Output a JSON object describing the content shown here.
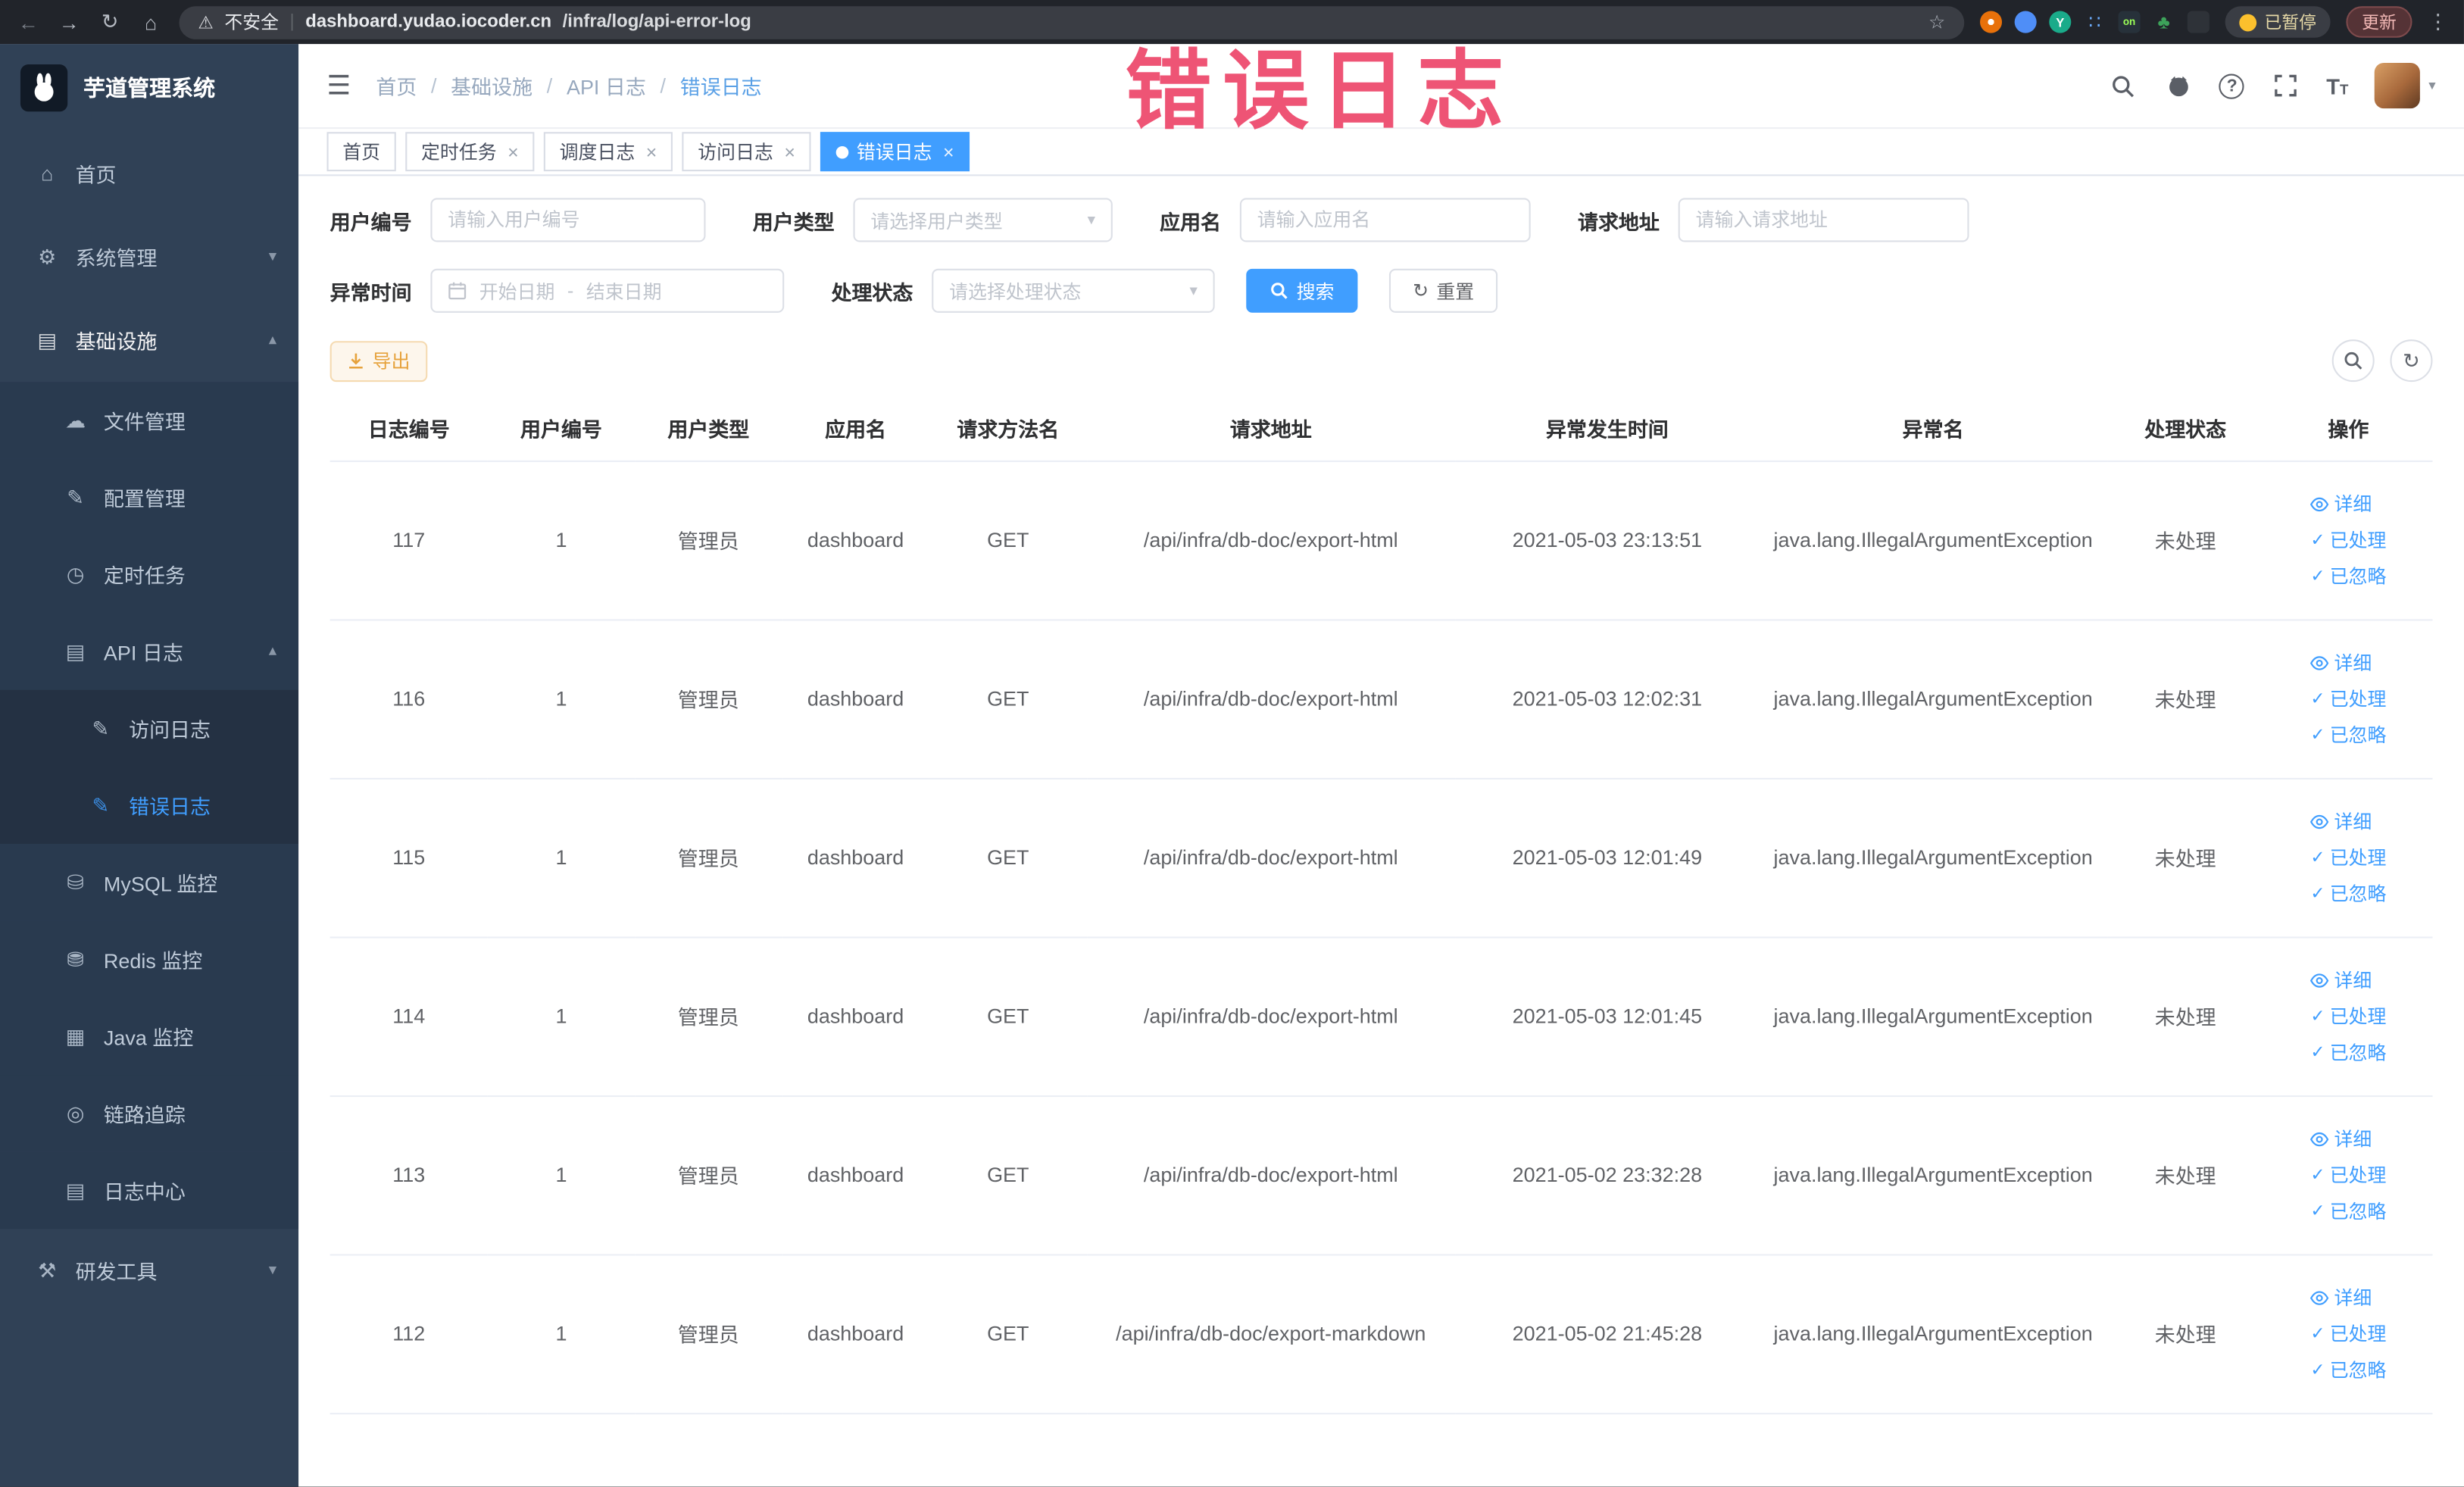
{
  "icons": {
    "back": "←",
    "forward": "→",
    "reload": "↻",
    "home": "⌂",
    "warning": "⚠",
    "divider": "|",
    "star": "☆",
    "more": "⋮",
    "hamburger": "☰",
    "slash": "/",
    "caret_down": "▾",
    "caret_up": "▴",
    "close": "×",
    "check": "✓",
    "select_caret": "▾",
    "reset": "↻",
    "refresh": "↻",
    "dots": "∷",
    "tree": "♣",
    "on_badge": "on",
    "y_badge": "Y"
  },
  "browser": {
    "security_label": "不安全",
    "domain": "dashboard.yudao.iocoder.cn",
    "path": "/infra/log/api-error-log",
    "paused_badge": "已暂停",
    "update_button": "更新"
  },
  "annotation": {
    "title": "错误日志"
  },
  "sidebar": {
    "logo_title": "芋道管理系统",
    "items": [
      {
        "label": "首页",
        "icon": "⌂"
      },
      {
        "label": "系统管理",
        "icon": "⚙"
      },
      {
        "label": "基础设施",
        "icon": "▤"
      },
      {
        "label": "文件管理",
        "icon": "☁"
      },
      {
        "label": "配置管理",
        "icon": "✎"
      },
      {
        "label": "定时任务",
        "icon": "◷"
      },
      {
        "label": "API 日志",
        "icon": "▤"
      },
      {
        "label": "访问日志",
        "icon": "✎"
      },
      {
        "label": "错误日志",
        "icon": "✎"
      },
      {
        "label": "MySQL 监控",
        "icon": "⛁"
      },
      {
        "label": "Redis 监控",
        "icon": "⛃"
      },
      {
        "label": "Java 监控",
        "icon": "▦"
      },
      {
        "label": "链路追踪",
        "icon": "◎"
      },
      {
        "label": "日志中心",
        "icon": "▤"
      },
      {
        "label": "研发工具",
        "icon": "⚒"
      }
    ]
  },
  "breadcrumb": [
    "首页",
    "基础设施",
    "API 日志",
    "错误日志"
  ],
  "tabs": [
    {
      "label": "首页"
    },
    {
      "label": "定时任务"
    },
    {
      "label": "调度日志"
    },
    {
      "label": "访问日志"
    },
    {
      "label": "错误日志"
    }
  ],
  "filters": {
    "user_id": {
      "label": "用户编号",
      "placeholder": "请输入用户编号"
    },
    "user_type": {
      "label": "用户类型",
      "placeholder": "请选择用户类型"
    },
    "app_name": {
      "label": "应用名",
      "placeholder": "请输入应用名"
    },
    "request_url": {
      "label": "请求地址",
      "placeholder": "请输入请求地址"
    },
    "exception_time": {
      "label": "异常时间",
      "start_placeholder": "开始日期",
      "separator": "-",
      "end_placeholder": "结束日期"
    },
    "process_status": {
      "label": "处理状态",
      "placeholder": "请选择处理状态"
    },
    "search_button": "搜索",
    "reset_button": "重置"
  },
  "toolbar": {
    "export_button": "导出"
  },
  "table": {
    "headers": [
      "日志编号",
      "用户编号",
      "用户类型",
      "应用名",
      "请求方法名",
      "请求地址",
      "异常发生时间",
      "异常名",
      "处理状态",
      "操作"
    ],
    "actions": {
      "detail": "详细",
      "processed": "已处理",
      "ignored": "已忽略"
    },
    "rows": [
      {
        "id": "117",
        "user_id": "1",
        "user_type": "管理员",
        "app": "dashboard",
        "method": "GET",
        "url": "/api/infra/db-doc/export-html",
        "time": "2021-05-03 23:13:51",
        "exception": "java.lang.IllegalArgumentException",
        "status": "未处理"
      },
      {
        "id": "116",
        "user_id": "1",
        "user_type": "管理员",
        "app": "dashboard",
        "method": "GET",
        "url": "/api/infra/db-doc/export-html",
        "time": "2021-05-03 12:02:31",
        "exception": "java.lang.IllegalArgumentException",
        "status": "未处理"
      },
      {
        "id": "115",
        "user_id": "1",
        "user_type": "管理员",
        "app": "dashboard",
        "method": "GET",
        "url": "/api/infra/db-doc/export-html",
        "time": "2021-05-03 12:01:49",
        "exception": "java.lang.IllegalArgumentException",
        "status": "未处理"
      },
      {
        "id": "114",
        "user_id": "1",
        "user_type": "管理员",
        "app": "dashboard",
        "method": "GET",
        "url": "/api/infra/db-doc/export-html",
        "time": "2021-05-03 12:01:45",
        "exception": "java.lang.IllegalArgumentException",
        "status": "未处理"
      },
      {
        "id": "113",
        "user_id": "1",
        "user_type": "管理员",
        "app": "dashboard",
        "method": "GET",
        "url": "/api/infra/db-doc/export-html",
        "time": "2021-05-02 23:32:28",
        "exception": "java.lang.IllegalArgumentException",
        "status": "未处理"
      },
      {
        "id": "112",
        "user_id": "1",
        "user_type": "管理员",
        "app": "dashboard",
        "method": "GET",
        "url": "/api/infra/db-doc/export-markdown",
        "time": "2021-05-02 21:45:28",
        "exception": "java.lang.IllegalArgumentException",
        "status": "未处理"
      }
    ]
  }
}
